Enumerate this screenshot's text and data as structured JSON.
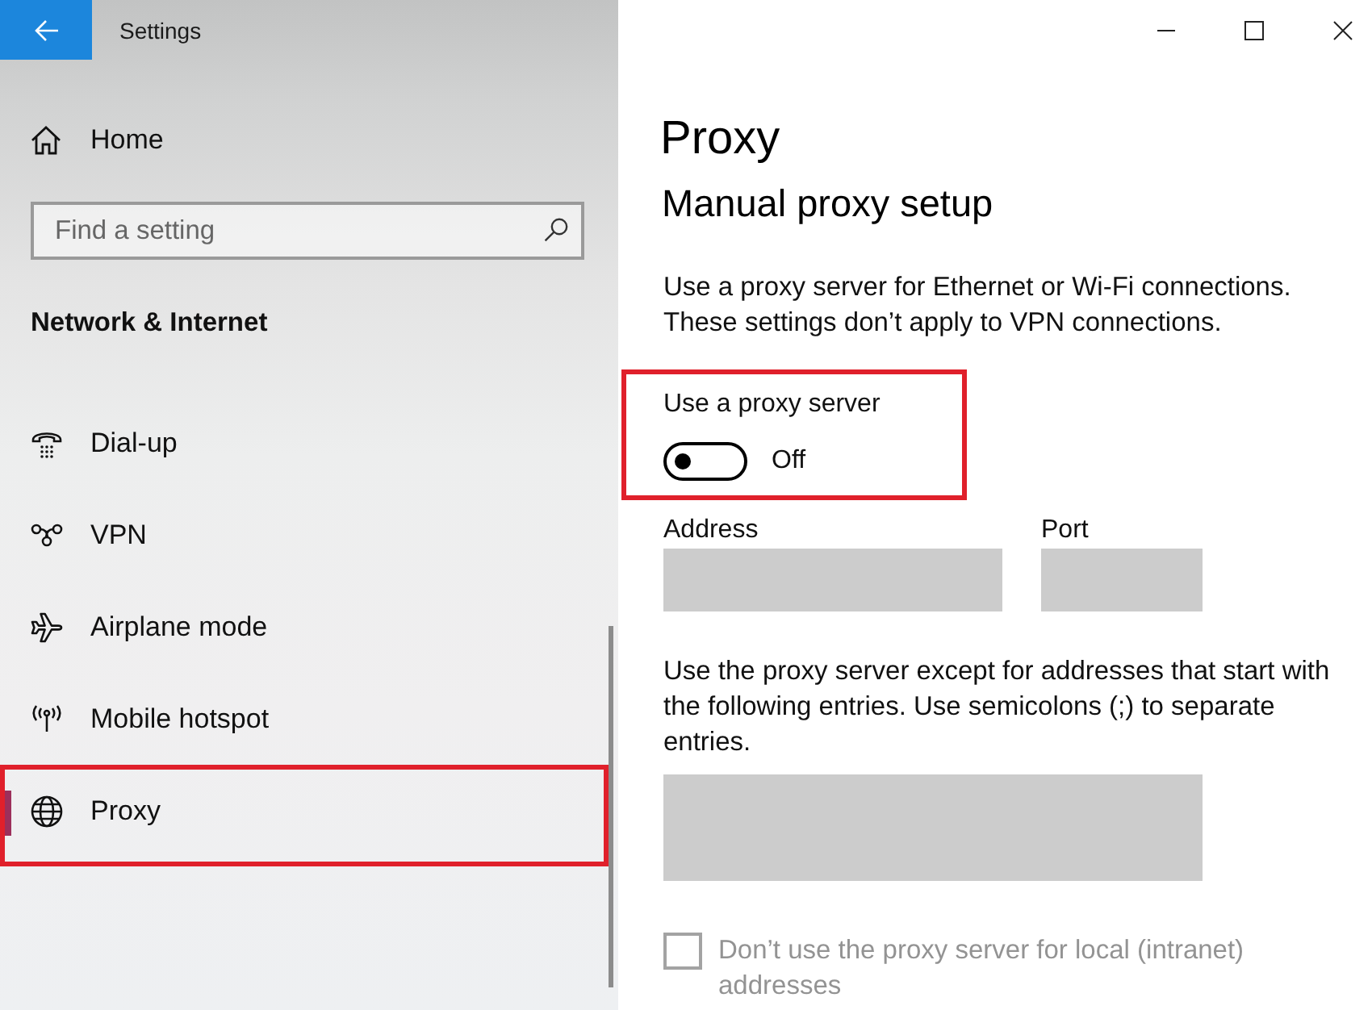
{
  "window": {
    "title": "Settings"
  },
  "sidebar": {
    "home": {
      "label": "Home"
    },
    "search": {
      "placeholder": "Find a setting"
    },
    "section_title": "Network & Internet",
    "items": [
      {
        "label": "Dial-up",
        "selected": false,
        "highlighted": false
      },
      {
        "label": "VPN",
        "selected": false,
        "highlighted": false
      },
      {
        "label": "Airplane mode",
        "selected": false,
        "highlighted": false
      },
      {
        "label": "Mobile hotspot",
        "selected": false,
        "highlighted": false
      },
      {
        "label": "Proxy",
        "selected": true,
        "highlighted": true
      }
    ]
  },
  "page": {
    "title": "Proxy",
    "subtitle": "Manual proxy setup",
    "description": "Use a proxy server for Ethernet or Wi-Fi connections. These settings don’t apply to VPN connections.",
    "proxy_switch": {
      "label": "Use a proxy server",
      "on": false,
      "state_label": "Off",
      "highlighted": true
    },
    "address": {
      "label": "Address",
      "disabled": true
    },
    "port": {
      "label": "Port",
      "disabled": true
    },
    "exceptions": {
      "description": "Use the proxy server except for addresses that start with the following entries. Use semicolons (;) to separate entries.",
      "disabled": true
    },
    "bypass_local": {
      "label": "Don’t use the proxy server for local (intranet) addresses",
      "checked": false,
      "disabled": true
    }
  }
}
